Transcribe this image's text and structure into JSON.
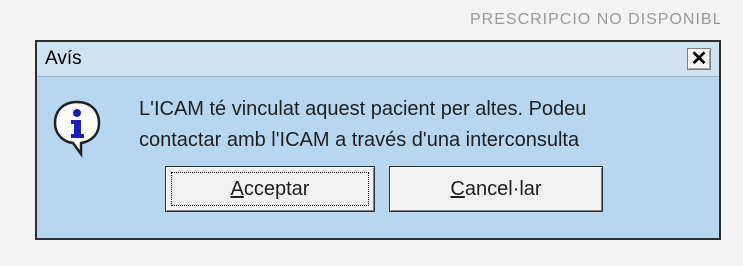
{
  "background": {
    "fragment_text": "PRESCRIPCIO NO DISPONIBLE"
  },
  "dialog": {
    "title": "Avís",
    "close_symbol": "✕",
    "icon": "information-icon",
    "message_line1": "L'ICAM té vinculat aquest pacient per altes. Podeu",
    "message_line2": "contactar amb l'ICAM a través d'una interconsulta",
    "buttons": {
      "accept": {
        "access_key": "A",
        "rest": "cceptar"
      },
      "cancel": {
        "access_key": "C",
        "rest": "ancel·lar"
      }
    }
  },
  "colors": {
    "dialog_background": "#b7d7f1",
    "icon_blue": "#1b1fb8",
    "button_face": "#f1f1f1"
  }
}
